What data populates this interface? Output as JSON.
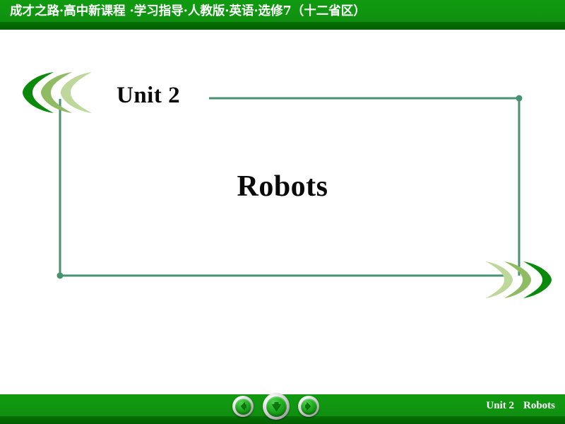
{
  "header": {
    "banner_text": "成才之路·高中新课程 ·学习指导·人教版·英语·选修7（十二省区）",
    "bright_green": "#119611",
    "dark_green": "#046904"
  },
  "slide": {
    "unit_label": "Unit 2",
    "main_title": "Robots",
    "frame_line_color": "#479271",
    "background": "#ffffff"
  },
  "decorations": {
    "left_chevrons": {
      "name": "triple-crescent-left",
      "direction": "left",
      "colors": [
        "#0a8a0a",
        "#8fbc62",
        "#bed79b"
      ]
    },
    "right_chevrons": {
      "name": "triple-crescent-right",
      "direction": "right",
      "colors": [
        "#bed79b",
        "#8fbc62",
        "#0a8a0a"
      ]
    }
  },
  "nav": {
    "prev": {
      "icon": "arrow-left-icon",
      "glyph": "←"
    },
    "down": {
      "icon": "arrow-down-icon",
      "glyph": "↓"
    },
    "next": {
      "icon": "arrow-right-icon",
      "glyph": "→"
    }
  },
  "footer": {
    "unit_label": "Unit 2",
    "title_label": "Robots"
  }
}
